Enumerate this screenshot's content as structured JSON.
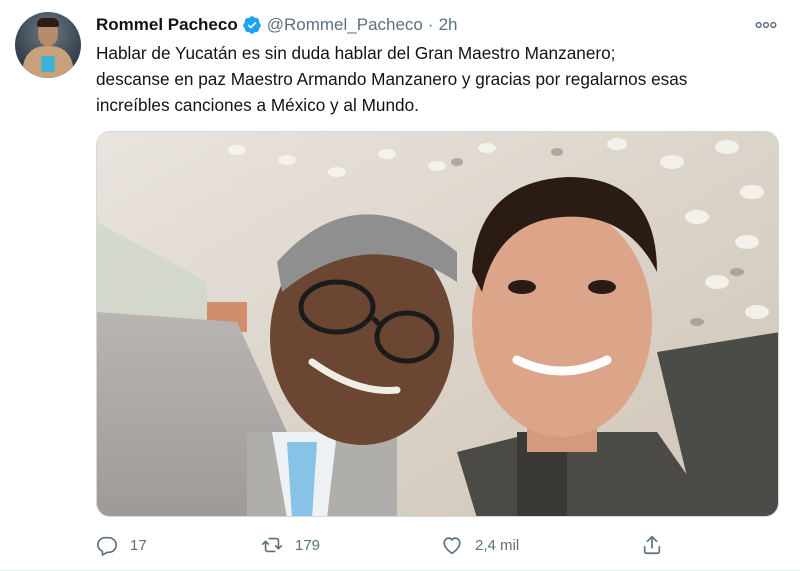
{
  "tweet": {
    "author_name": "Rommel Pacheco",
    "handle": "@Rommel_Pacheco",
    "separator": "·",
    "time": "2h",
    "more_label": "ooo",
    "text_lines": [
      "Hablar de Yucatán es sin duda hablar del Gran Maestro Manzanero;",
      "descanse en paz Maestro Armando Manzanero y gracias por regalarnos esas",
      "increíbles canciones a México y al Mundo."
    ]
  },
  "actions": {
    "reply_count": "17",
    "retweet_count": "179",
    "like_count": "2,4 mil"
  },
  "colors": {
    "verified": "#1da1f2",
    "secondary_text": "#5b7083",
    "primary_text": "#0f1419"
  },
  "icons": [
    "verified-badge-icon",
    "more-icon",
    "reply-icon",
    "retweet-icon",
    "like-icon",
    "share-icon"
  ]
}
